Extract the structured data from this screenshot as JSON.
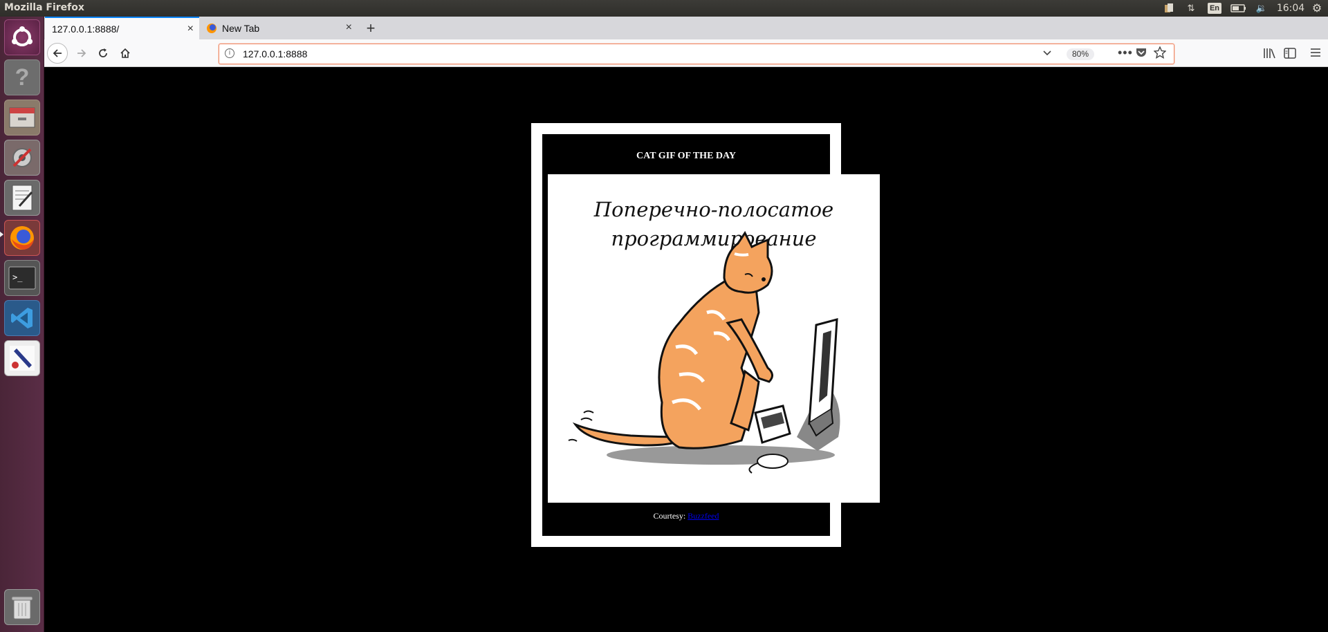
{
  "system": {
    "window_title": "Mozilla Firefox",
    "keyboard_layout": "En",
    "clock": "16:04"
  },
  "launcher": {
    "items": [
      "ubuntu-dash-icon",
      "help-icon",
      "files-icon",
      "settings-icon",
      "text-editor-icon",
      "firefox-icon",
      "terminal-icon",
      "vscode-icon",
      "image-app-icon",
      "trash-icon"
    ]
  },
  "browser": {
    "tabs": [
      {
        "label": "127.0.0.1:8888/"
      },
      {
        "label": "New Tab"
      }
    ],
    "new_tab_symbol": "+",
    "close_symbol": "×",
    "url": "127.0.0.1:8888",
    "zoom": "80%"
  },
  "page": {
    "card_title": "CAT GIF OF THE DAY",
    "gif_caption_line1": "Поперечно-полосатое",
    "gif_caption_line2": "программирование",
    "courtesy_label": "Courtesy:",
    "courtesy_link": "Buzzfeed"
  },
  "colors": {
    "cat_orange": "#f4a35e",
    "tab_accent": "#0a84ff",
    "url_focus": "#f08c6c"
  }
}
